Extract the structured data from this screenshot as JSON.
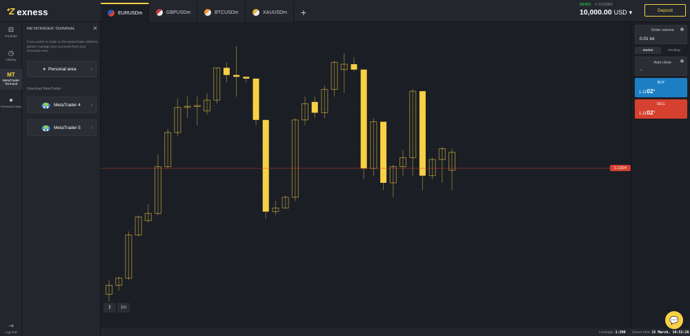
{
  "brand": {
    "name": "exness"
  },
  "tabs": [
    {
      "label": "EURUSDm",
      "active": true,
      "icon": "eu-us-flag-icon"
    },
    {
      "label": "GBPUSDm",
      "active": false,
      "icon": "gb-us-flag-icon"
    },
    {
      "label": "BTCUSDm",
      "active": false,
      "icon": "btc-usd-icon"
    },
    {
      "label": "XAUUSDm",
      "active": false,
      "icon": "gold-usd-icon"
    }
  ],
  "tab_add": "+",
  "account": {
    "type": "DEMO",
    "number": "# 1253982",
    "balance": "10,000.00",
    "currency": "USD"
  },
  "deposit_label": "Deposit",
  "sidenav": {
    "items": [
      {
        "label": "Portfolio",
        "icon": "briefcase-icon"
      },
      {
        "label": "History",
        "icon": "history-icon"
      },
      {
        "label": "MetaTrader Terminal",
        "icon": "MT"
      },
      {
        "label": "Personal area",
        "icon": "user-icon"
      }
    ],
    "logout": "Log Out"
  },
  "mt_panel": {
    "title": "METATRADER TERMINAL",
    "description": "If you prefer to trade on the MetaTrader platform, please manage your accounts from your Personal Area",
    "personal_area": "Personal area",
    "download_label": "Download MetaTrader",
    "mt4": "MetaTrader 4",
    "mt5": "MetaTrader 5"
  },
  "chart": {
    "current_price": "1.11024",
    "timeframe": "1m",
    "candle_color": "#f7d046",
    "price_line_color": "#d6402f"
  },
  "order_panel": {
    "volume_label": "Order volume",
    "volume_value": "0.01 lot",
    "types": [
      "Market",
      "Pending"
    ],
    "auto_close_label": "Auto close",
    "auto_close_value": "–",
    "buy_label": "BUY",
    "buy_price": {
      "pre": "1.11",
      "big": "02",
      "sup": "4"
    },
    "sell_label": "SELL",
    "sell_price": {
      "pre": "1.11",
      "big": "02",
      "sup": "4"
    }
  },
  "status": {
    "leverage_label": "Leverage:",
    "leverage": "1:200",
    "time_label": "Server time:",
    "time": "15 March, 10:53:26"
  },
  "chart_data": {
    "type": "candlestick",
    "candles": [
      {
        "o": 0.0,
        "h": 0.4,
        "l": -0.2,
        "c": 0.25
      },
      {
        "o": 0.25,
        "h": 0.5,
        "l": 0.1,
        "c": 0.45
      },
      {
        "o": 0.45,
        "h": 1.75,
        "l": 0.4,
        "c": 1.65
      },
      {
        "o": 1.65,
        "h": 2.2,
        "l": 1.6,
        "c": 2.15
      },
      {
        "o": 2.05,
        "h": 2.5,
        "l": 2.0,
        "c": 2.25
      },
      {
        "o": 2.25,
        "h": 3.9,
        "l": 2.2,
        "c": 3.55
      },
      {
        "o": 3.55,
        "h": 4.6,
        "l": 3.5,
        "c": 4.5
      },
      {
        "o": 4.5,
        "h": 5.45,
        "l": 4.4,
        "c": 5.2
      },
      {
        "o": 5.2,
        "h": 5.5,
        "l": 4.9,
        "c": 5.23
      },
      {
        "o": 5.23,
        "h": 5.5,
        "l": 4.7,
        "c": 5.25
      },
      {
        "o": 5.1,
        "h": 5.6,
        "l": 5.0,
        "c": 5.4
      },
      {
        "o": 5.4,
        "h": 6.3,
        "l": 5.3,
        "c": 6.3
      },
      {
        "o": 6.3,
        "h": 6.45,
        "l": 5.9,
        "c": 6.1
      },
      {
        "o": 6.1,
        "h": 6.9,
        "l": 5.5,
        "c": 6.05
      },
      {
        "o": 6.05,
        "h": 6.05,
        "l": 5.9,
        "c": 6.0
      },
      {
        "o": 6.0,
        "h": 6.0,
        "l": 4.7,
        "c": 4.85
      },
      {
        "o": 4.85,
        "h": 4.85,
        "l": 2.1,
        "c": 2.3
      },
      {
        "o": 2.3,
        "h": 2.6,
        "l": 2.2,
        "c": 2.4
      },
      {
        "o": 2.4,
        "h": 2.75,
        "l": 2.4,
        "c": 2.7
      },
      {
        "o": 2.7,
        "h": 4.9,
        "l": 2.6,
        "c": 4.85
      },
      {
        "o": 4.85,
        "h": 5.5,
        "l": 4.7,
        "c": 5.3
      },
      {
        "o": 5.35,
        "h": 5.5,
        "l": 4.9,
        "c": 5.05
      },
      {
        "o": 5.05,
        "h": 5.8,
        "l": 4.9,
        "c": 5.7
      },
      {
        "o": 5.7,
        "h": 6.5,
        "l": 5.5,
        "c": 6.45
      },
      {
        "o": 6.25,
        "h": 6.7,
        "l": 5.6,
        "c": 6.4
      },
      {
        "o": 6.4,
        "h": 6.6,
        "l": 6.2,
        "c": 6.25
      },
      {
        "o": 6.25,
        "h": 6.25,
        "l": 3.2,
        "c": 3.5
      },
      {
        "o": 3.5,
        "h": 4.9,
        "l": 3.3,
        "c": 4.8
      },
      {
        "o": 4.8,
        "h": 4.8,
        "l": 2.9,
        "c": 3.1
      },
      {
        "o": 3.1,
        "h": 3.6,
        "l": 2.7,
        "c": 3.55
      },
      {
        "o": 3.55,
        "h": 4.0,
        "l": 3.3,
        "c": 3.8
      },
      {
        "o": 3.8,
        "h": 5.7,
        "l": 3.3,
        "c": 5.65
      },
      {
        "o": 5.65,
        "h": 5.65,
        "l": 2.9,
        "c": 3.3
      },
      {
        "o": 3.3,
        "h": 3.8,
        "l": 3.2,
        "c": 3.75
      },
      {
        "o": 3.75,
        "h": 4.1,
        "l": 3.1,
        "c": 4.05
      },
      {
        "o": 3.45,
        "h": 4.05,
        "l": 2.9,
        "c": 3.95
      }
    ]
  }
}
